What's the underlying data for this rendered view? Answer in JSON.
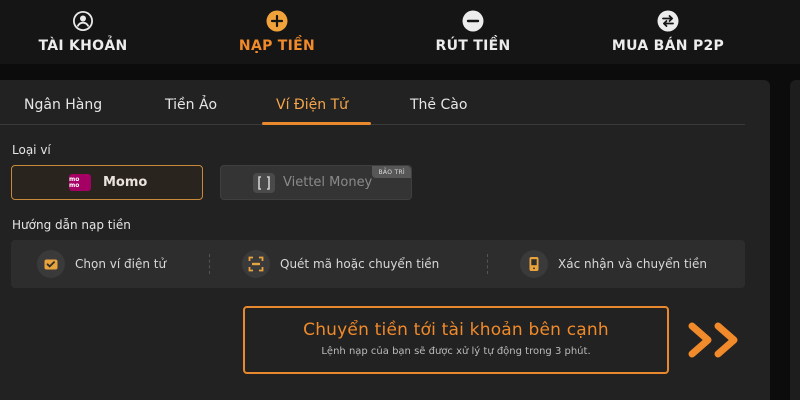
{
  "nav": {
    "items": [
      {
        "label": "TÀI KHOẢN",
        "icon": "user-icon"
      },
      {
        "label": "NẠP TIỀN",
        "icon": "plus-icon"
      },
      {
        "label": "RÚT TIỀN",
        "icon": "minus-icon"
      },
      {
        "label": "MUA BÁN P2P",
        "icon": "exchange-icon"
      }
    ],
    "active_color": "#f08a2a"
  },
  "tabs": [
    {
      "label": "Ngân Hàng"
    },
    {
      "label": "Tiền Ảo"
    },
    {
      "label": "Ví Điện Tử"
    },
    {
      "label": "Thẻ Cào"
    }
  ],
  "wallet_section": {
    "label": "Loại ví",
    "options": [
      {
        "name": "Momo",
        "logo_text": "mo mo",
        "selected": true
      },
      {
        "name": "Viettel Money",
        "badge": "BẢO TRÌ",
        "selected": false
      }
    ]
  },
  "guide": {
    "label": "Hướng dẫn nạp tiền",
    "steps": [
      {
        "text": "Chọn ví điện tử",
        "icon": "wallet-check-icon"
      },
      {
        "text": "Quét mã hoặc chuyển tiền",
        "icon": "scan-icon"
      },
      {
        "text": "Xác nhận và chuyển tiền",
        "icon": "phone-confirm-icon"
      }
    ]
  },
  "cta": {
    "title": "Chuyển tiền tới tài khoản bên cạnh",
    "subtitle": "Lệnh nạp của bạn sẽ được xử lý tự động trong 3 phút.",
    "arrow_icon": "double-chevron-right-icon"
  },
  "colors": {
    "accent": "#e8892e",
    "background": "#0c0c0c",
    "panel": "#222222"
  }
}
